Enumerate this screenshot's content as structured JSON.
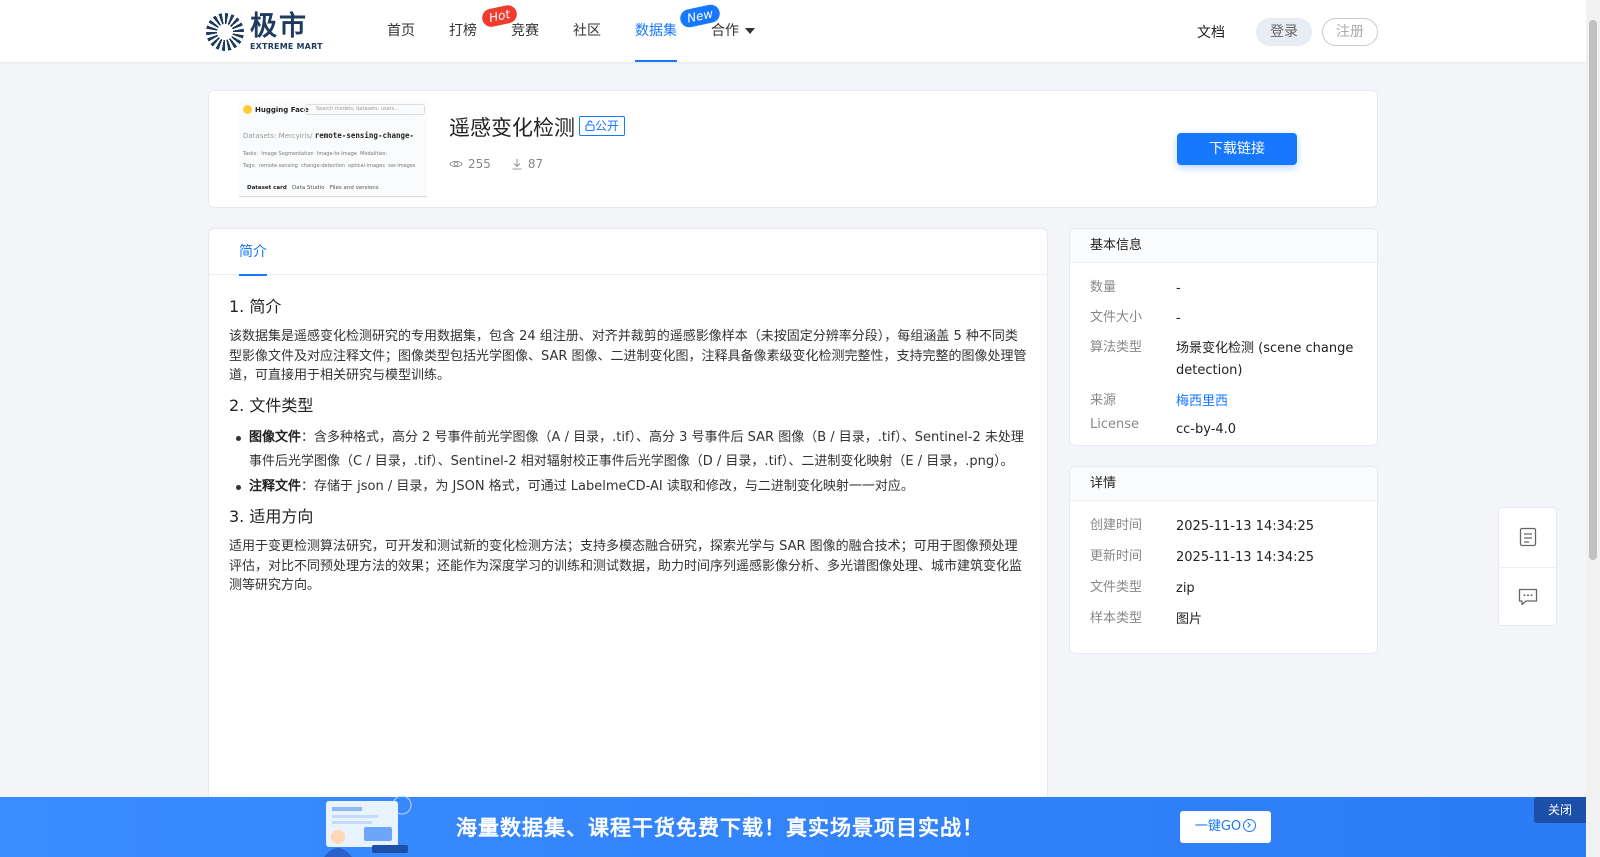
{
  "header": {
    "logo": {
      "cn": "极市",
      "en": "EXTREME MART"
    },
    "nav": [
      {
        "label": "首页"
      },
      {
        "label": "打榜",
        "badge": "Hot"
      },
      {
        "label": "竞赛"
      },
      {
        "label": "社区"
      },
      {
        "label": "数据集",
        "badge": "New",
        "active": true
      },
      {
        "label": "合作",
        "dropdown": true
      }
    ],
    "docs": "文档",
    "login": "登录",
    "register": "注册"
  },
  "dataset": {
    "title": "遥感变化检测",
    "visibility": "公开",
    "views": "255",
    "downloads": "87",
    "download_button": "下载链接",
    "thumbnail": {
      "site": "Hugging Face",
      "search_placeholder": "Search models, datasets, users...",
      "prefix": "Datasets:",
      "owner": "Mercyiris",
      "repo": "remote-sensing-change-",
      "tasks_label": "Tasks:",
      "task1": "Image Segmentation",
      "task2": "Image-to-Image",
      "modalities": "Modalities:",
      "tags_label": "Tags:",
      "tag1": "remote-sensing",
      "tag2": "change-detection",
      "tag3": "optical-images",
      "tag4": "sar-images",
      "tab1": "Dataset card",
      "tab2": "Data Studio",
      "tab3": "Files and versions"
    }
  },
  "tabs": {
    "intro": "简介"
  },
  "article": {
    "h1": "1. 简介",
    "p1": "该数据集是遥感变化检测研究的专用数据集，包含 24 组注册、对齐并裁剪的遥感影像样本（未按固定分辨率分段），每组涵盖 5 种不同类型影像文件及对应注释文件；图像类型包括光学图像、SAR 图像、二进制变化图，注释具备像素级变化检测完整性，支持完整的图像处理管道，可直接用于相关研究与模型训练。",
    "h2": "2. 文件类型",
    "li1_title": "图像文件",
    "li1_body": "：含多种格式，高分 2 号事件前光学图像（A / 目录，.tif）、高分 3 号事件后 SAR 图像（B / 目录，.tif）、Sentinel-2 未处理事件后光学图像（C / 目录，.tif）、Sentinel-2 相对辐射校正事件后光学图像（D / 目录，.tif）、二进制变化映射（E / 目录，.png）。",
    "li2_title": "注释文件",
    "li2_body": "：存储于 json / 目录，为 JSON 格式，可通过 LabelmeCD-AI 读取和修改，与二进制变化映射一一对应。",
    "h3": "3. 适用方向",
    "p3": "适用于变更检测算法研究，可开发和测试新的变化检测方法；支持多模态融合研究，探索光学与 SAR 图像的融合技术；可用于图像预处理评估，对比不同预处理方法的效果；还能作为深度学习的训练和测试数据，助力时间序列遥感影像分析、多光谱图像处理、城市建筑变化监测等研究方向。"
  },
  "basic_info": {
    "title": "基本信息",
    "rows": [
      {
        "key": "数量",
        "value": "-"
      },
      {
        "key": "文件大小",
        "value": "-"
      },
      {
        "key": "算法类型",
        "value": "场景变化检测 (scene change detection)"
      },
      {
        "key": "来源",
        "value": "梅西里西"
      },
      {
        "key": "License",
        "value": "cc-by-4.0"
      }
    ]
  },
  "details": {
    "title": "详情",
    "rows": [
      {
        "key": "创建时间",
        "value": "2025-11-13 14:34:25"
      },
      {
        "key": "更新时间",
        "value": "2025-11-13 14:34:25"
      },
      {
        "key": "文件类型",
        "value": "zip"
      },
      {
        "key": "样本类型",
        "value": "图片"
      }
    ]
  },
  "promo": {
    "text": "海量数据集、课程干货免费下载！真实场景项目实战！",
    "go": "一键GO",
    "close": "关闭"
  },
  "colors": {
    "accent": "#1677ff",
    "hot": "#f03c2e",
    "promo": "#3b8cff"
  }
}
